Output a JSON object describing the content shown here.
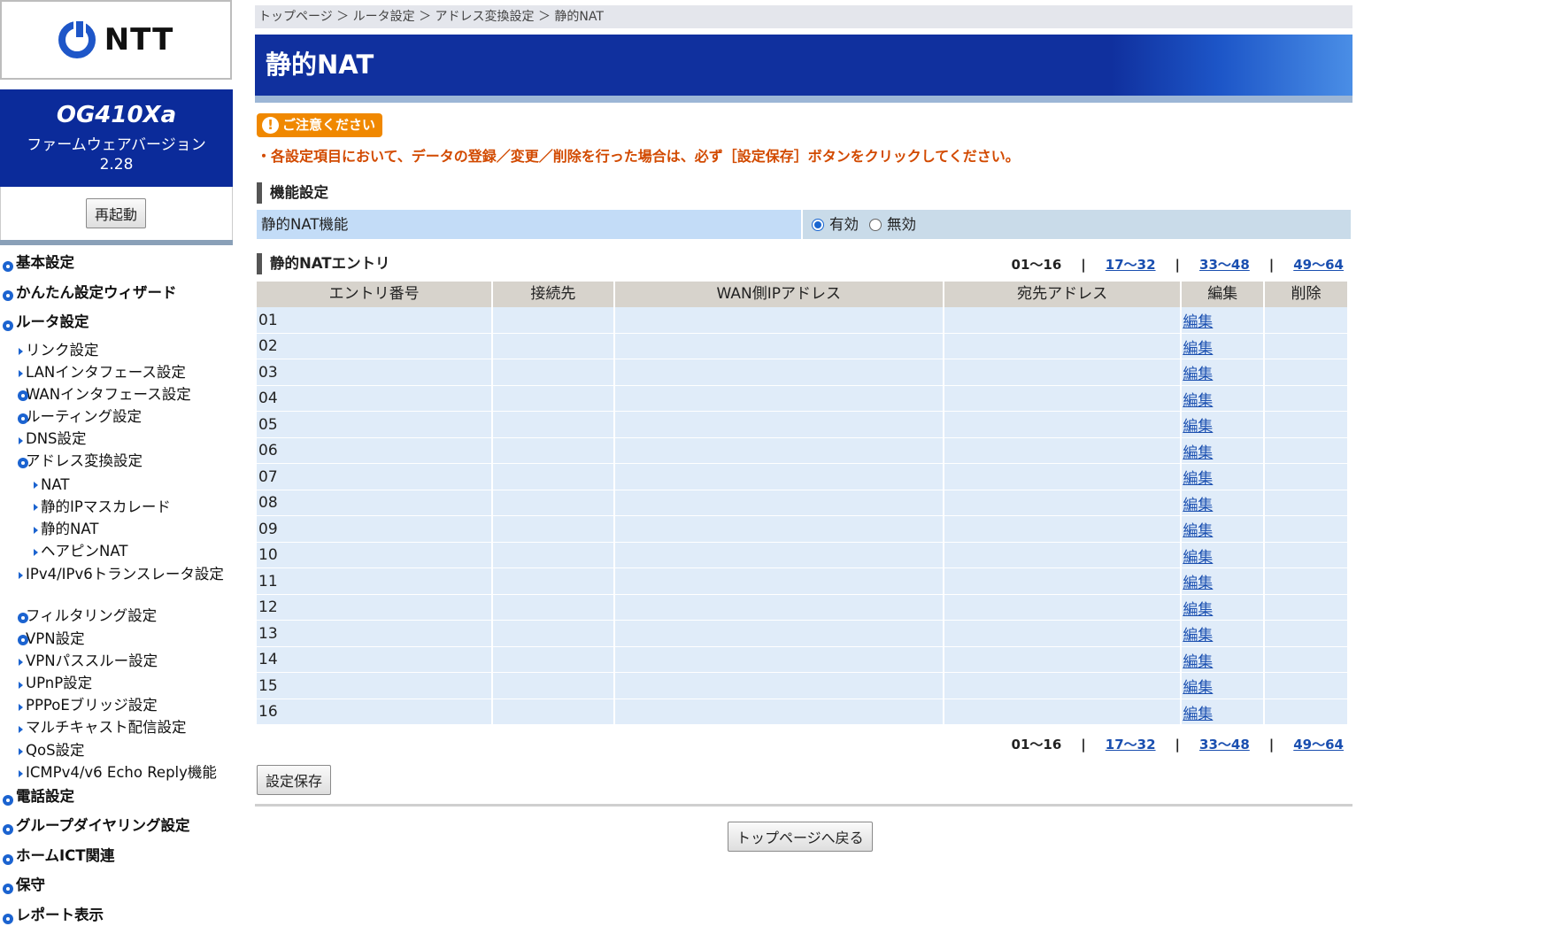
{
  "sidebar": {
    "logo_text": "NTT",
    "model": "OG410Xa",
    "firmware_label": "ファームウェアバージョン",
    "firmware_version": "2.28",
    "reboot_label": "再起動",
    "nav": [
      {
        "label": "基本設定",
        "level": 0,
        "bullet": "dot"
      },
      {
        "label": "かんたん設定ウィザード",
        "level": 0,
        "bullet": "dot"
      },
      {
        "label": "ルータ設定",
        "level": 0,
        "bullet": "dot"
      },
      {
        "label": "リンク設定",
        "level": 1,
        "bullet": "tri"
      },
      {
        "label": "LANインタフェース設定",
        "level": 1,
        "bullet": "tri"
      },
      {
        "label": "WANインタフェース設定",
        "level": 1,
        "bullet": "dot"
      },
      {
        "label": "ルーティング設定",
        "level": 1,
        "bullet": "dot"
      },
      {
        "label": "DNS設定",
        "level": 1,
        "bullet": "tri"
      },
      {
        "label": "アドレス変換設定",
        "level": 1,
        "bullet": "dot"
      },
      {
        "label": "NAT",
        "level": 2,
        "bullet": "tri"
      },
      {
        "label": "静的IPマスカレード",
        "level": 2,
        "bullet": "tri"
      },
      {
        "label": "静的NAT",
        "level": 2,
        "bullet": "tri"
      },
      {
        "label": "ヘアピンNAT",
        "level": 2,
        "bullet": "tri"
      },
      {
        "label": "IPv4/IPv6トランスレータ設定",
        "level": 1,
        "bullet": "tri",
        "wrap": true
      },
      {
        "label": "フィルタリング設定",
        "level": 1,
        "bullet": "dot"
      },
      {
        "label": "VPN設定",
        "level": 1,
        "bullet": "dot"
      },
      {
        "label": "VPNパススルー設定",
        "level": 1,
        "bullet": "tri"
      },
      {
        "label": "UPnP設定",
        "level": 1,
        "bullet": "tri"
      },
      {
        "label": "PPPoEブリッジ設定",
        "level": 1,
        "bullet": "tri"
      },
      {
        "label": "マルチキャスト配信設定",
        "level": 1,
        "bullet": "tri"
      },
      {
        "label": "QoS設定",
        "level": 1,
        "bullet": "tri"
      },
      {
        "label": "ICMPv4/v6 Echo Reply機能",
        "level": 1,
        "bullet": "tri"
      },
      {
        "label": "電話設定",
        "level": 0,
        "bullet": "dot"
      },
      {
        "label": "グループダイヤリング設定",
        "level": 0,
        "bullet": "dot"
      },
      {
        "label": "ホームICT関連",
        "level": 0,
        "bullet": "dot"
      },
      {
        "label": "保守",
        "level": 0,
        "bullet": "dot"
      },
      {
        "label": "レポート表示",
        "level": 0,
        "bullet": "dot"
      }
    ]
  },
  "breadcrumb": "トップページ ＞ ルータ設定 ＞ アドレス変換設定 ＞ 静的NAT",
  "page_title": "静的NAT",
  "caution": {
    "badge": "ご注意ください",
    "icon": "!",
    "text": "・各設定項目において、データの登録／変更／削除を行った場合は、必ず［設定保存］ボタンをクリックしてください。"
  },
  "function_settings": {
    "heading": "機能設定",
    "label": "静的NAT機能",
    "enabled_label": "有効",
    "disabled_label": "無効",
    "selected": "有効"
  },
  "entries": {
    "heading": "静的NATエントリ",
    "pager": {
      "current": "01～16",
      "links": [
        "17～32",
        "33～48",
        "49～64"
      ],
      "separator": "|"
    },
    "columns": [
      "エントリ番号",
      "接続先",
      "WAN側IPアドレス",
      "宛先アドレス",
      "編集",
      "削除"
    ],
    "rows": [
      {
        "num": "01",
        "edit": "編集"
      },
      {
        "num": "02",
        "edit": "編集"
      },
      {
        "num": "03",
        "edit": "編集"
      },
      {
        "num": "04",
        "edit": "編集"
      },
      {
        "num": "05",
        "edit": "編集"
      },
      {
        "num": "06",
        "edit": "編集"
      },
      {
        "num": "07",
        "edit": "編集"
      },
      {
        "num": "08",
        "edit": "編集"
      },
      {
        "num": "09",
        "edit": "編集"
      },
      {
        "num": "10",
        "edit": "編集"
      },
      {
        "num": "11",
        "edit": "編集"
      },
      {
        "num": "12",
        "edit": "編集"
      },
      {
        "num": "13",
        "edit": "編集"
      },
      {
        "num": "14",
        "edit": "編集"
      },
      {
        "num": "15",
        "edit": "編集"
      },
      {
        "num": "16",
        "edit": "編集"
      }
    ]
  },
  "buttons": {
    "save": "設定保存",
    "back_to_top": "トップページへ戻る"
  },
  "colors": {
    "brand_blue": "#10309e",
    "caution_orange": "#f08800",
    "link": "#1a4fb0"
  }
}
